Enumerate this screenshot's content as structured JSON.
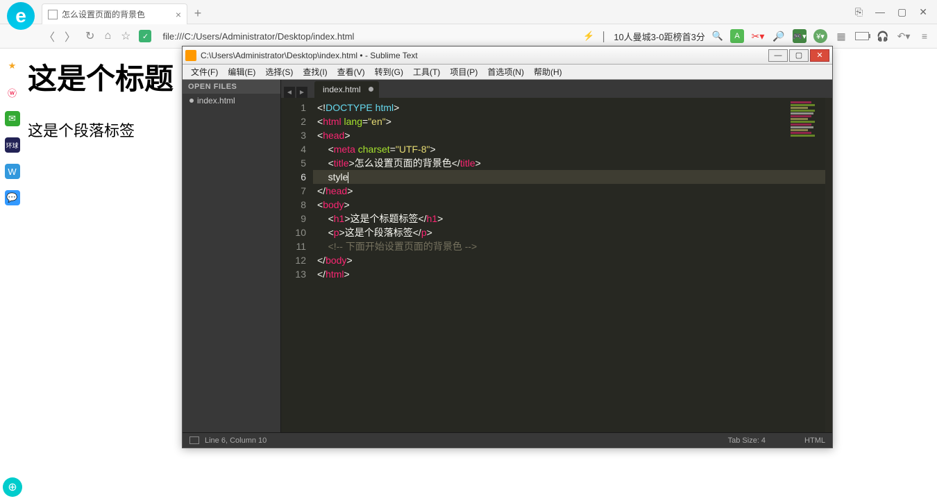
{
  "browser": {
    "tab_title": "怎么设置页面的背景色",
    "url": "file:///C:/Users/Administrator/Desktop/index.html",
    "news_text": "10人曼城3-0距榜首3分"
  },
  "page": {
    "heading": "这是个标题",
    "paragraph": "这是个段落标签"
  },
  "sublime": {
    "title": "C:\\Users\\Administrator\\Desktop\\index.html • - Sublime Text",
    "menus": [
      "文件(F)",
      "编辑(E)",
      "选择(S)",
      "查找(I)",
      "查看(V)",
      "转到(G)",
      "工具(T)",
      "项目(P)",
      "首选项(N)",
      "帮助(H)"
    ],
    "open_files_label": "OPEN FILES",
    "open_file": "index.html",
    "tab_label": "index.html",
    "line_numbers": [
      "1",
      "2",
      "3",
      "4",
      "5",
      "6",
      "7",
      "8",
      "9",
      "10",
      "11",
      "12",
      "13"
    ],
    "current_line_index": 5,
    "code": {
      "l1": {
        "a": "<!",
        "b": "DOCTYPE",
        "c": " html",
        "d": ">"
      },
      "l2": {
        "a": "<",
        "b": "html",
        "c": " lang",
        "d": "=",
        "e": "\"en\"",
        "f": ">"
      },
      "l3": {
        "a": "<",
        "b": "head",
        "c": ">"
      },
      "l4": {
        "a": "<",
        "b": "meta",
        "c": " charset",
        "d": "=",
        "e": "\"UTF-8\"",
        "f": ">"
      },
      "l5": {
        "a": "<",
        "b": "title",
        "c": ">",
        "d": "怎么设置页面的背景色",
        "e": "</",
        "f": "title",
        "g": ">"
      },
      "l6": {
        "a": "style"
      },
      "l7": {
        "a": "</",
        "b": "head",
        "c": ">"
      },
      "l8": {
        "a": "<",
        "b": "body",
        "c": ">"
      },
      "l9": {
        "a": "<",
        "b": "h1",
        "c": ">",
        "d": "这是个标题标签",
        "e": "</",
        "f": "h1",
        "g": ">"
      },
      "l10": {
        "a": "<",
        "b": "p",
        "c": ">",
        "d": "这是个段落标签",
        "e": "</",
        "f": "p",
        "g": ">"
      },
      "l11": {
        "a": "<!-- 下面开始设置页面的背景色 -->"
      },
      "l12": {
        "a": "</",
        "b": "body",
        "c": ">"
      },
      "l13": {
        "a": "</",
        "b": "html",
        "c": ">"
      }
    },
    "status": {
      "position": "Line 6, Column 10",
      "tabsize": "Tab Size: 4",
      "syntax": "HTML"
    }
  }
}
